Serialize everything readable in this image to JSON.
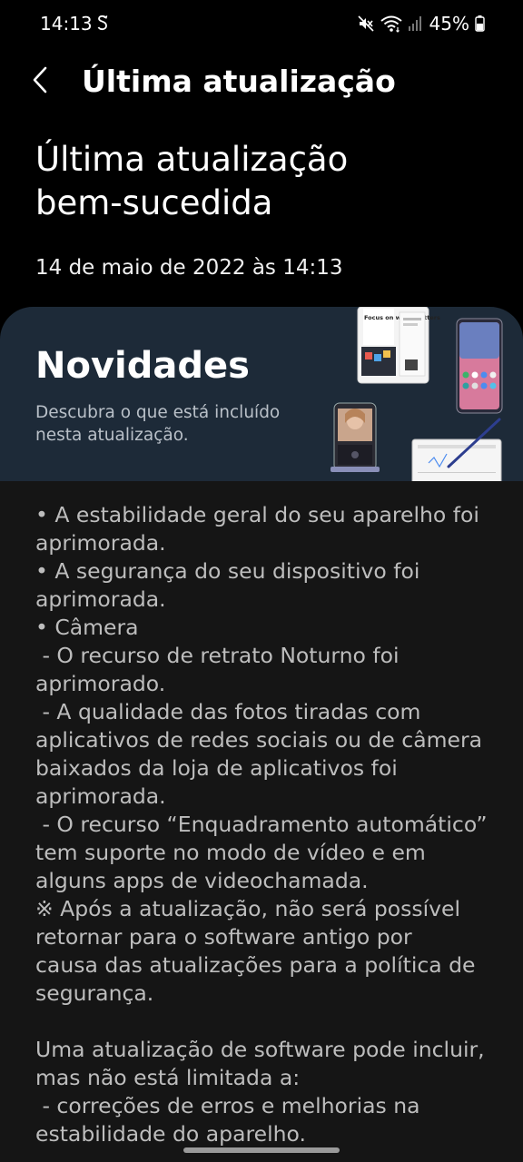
{
  "status_bar": {
    "time": "14:13",
    "battery": "45%",
    "icons": [
      "sync-s-icon",
      "mute-icon",
      "wifi-icon",
      "signal-icon",
      "battery-icon"
    ]
  },
  "app_bar": {
    "title": "Última atualização",
    "back_icon": "back-arrow-icon"
  },
  "result": {
    "title_line1": "Última atualização",
    "title_line2": "bem-sucedida",
    "date": "14 de maio de 2022 às 14:13"
  },
  "news": {
    "title": "Novidades",
    "subtitle_line1": "Descubra o que está incluído",
    "subtitle_line2": "nesta atualização.",
    "illustration_text": "Focus on what matters"
  },
  "notes": {
    "lines": [
      "• A estabilidade geral do seu aparelho foi",
      "aprimorada.",
      "• A segurança do seu dispositivo foi",
      "aprimorada.",
      "• Câmera",
      " - O recurso de retrato Noturno foi",
      "aprimorado.",
      " - A qualidade das fotos tiradas com",
      "aplicativos de redes sociais ou de câmera",
      "baixados da loja de aplicativos foi",
      "aprimorada.",
      " - O recurso “Enquadramento automático”",
      "tem suporte no modo de vídeo e em",
      "alguns apps de videochamada.",
      "※ Após a atualização, não será possível",
      "retornar para o software antigo por",
      "causa das atualizações para a política de",
      "segurança."
    ],
    "lines2": [
      "Uma atualização de software pode incluir,",
      "mas não está limitada a:",
      " - correções de erros e melhorias na",
      "estabilidade do aparelho."
    ]
  },
  "colors": {
    "background": "#000000",
    "card": "#1d2a38",
    "panel": "#151515",
    "note_text": "#bdbdbd"
  }
}
